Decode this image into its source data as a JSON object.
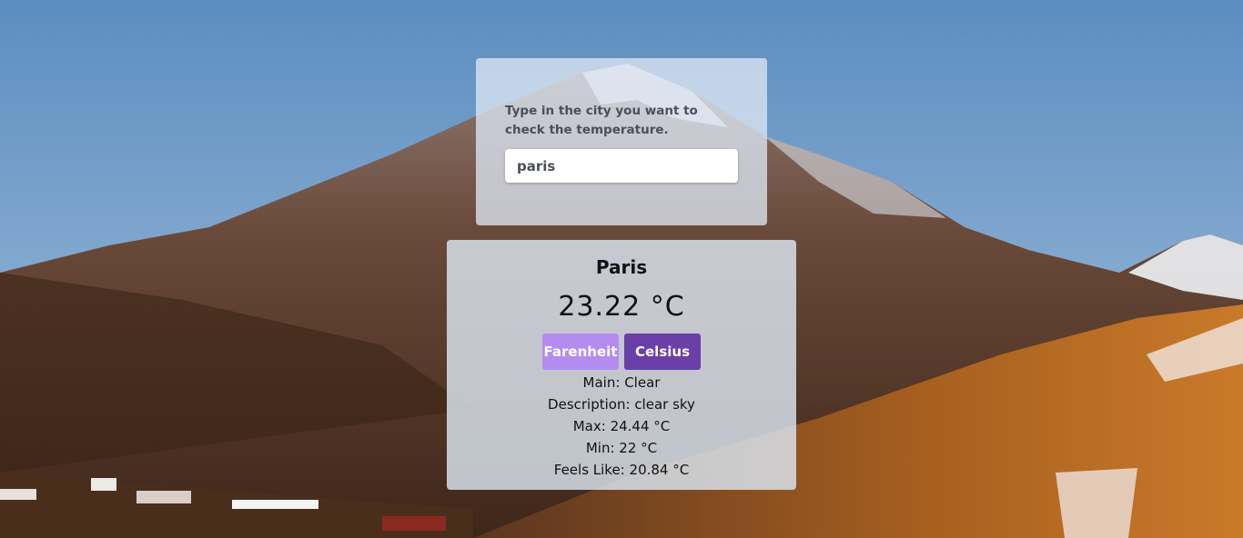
{
  "search": {
    "label": "Type in the city you want to check the temperature.",
    "value": "paris"
  },
  "result": {
    "city": "Paris",
    "temperature": "23.22 °C",
    "buttons": {
      "farenheit": "Farenheit",
      "celsius": "Celsius"
    },
    "details": [
      {
        "label": "Main:",
        "value": "Clear"
      },
      {
        "label": "Description:",
        "value": "clear sky"
      },
      {
        "label": "Max:",
        "value": "24.44 °C"
      },
      {
        "label": "Min:",
        "value": "22 °C"
      },
      {
        "label": "Feels Like:",
        "value": "20.84 °C"
      }
    ]
  },
  "colors": {
    "farenheit_button": "#b48cf0",
    "celsius_button": "#6a3fa8"
  }
}
